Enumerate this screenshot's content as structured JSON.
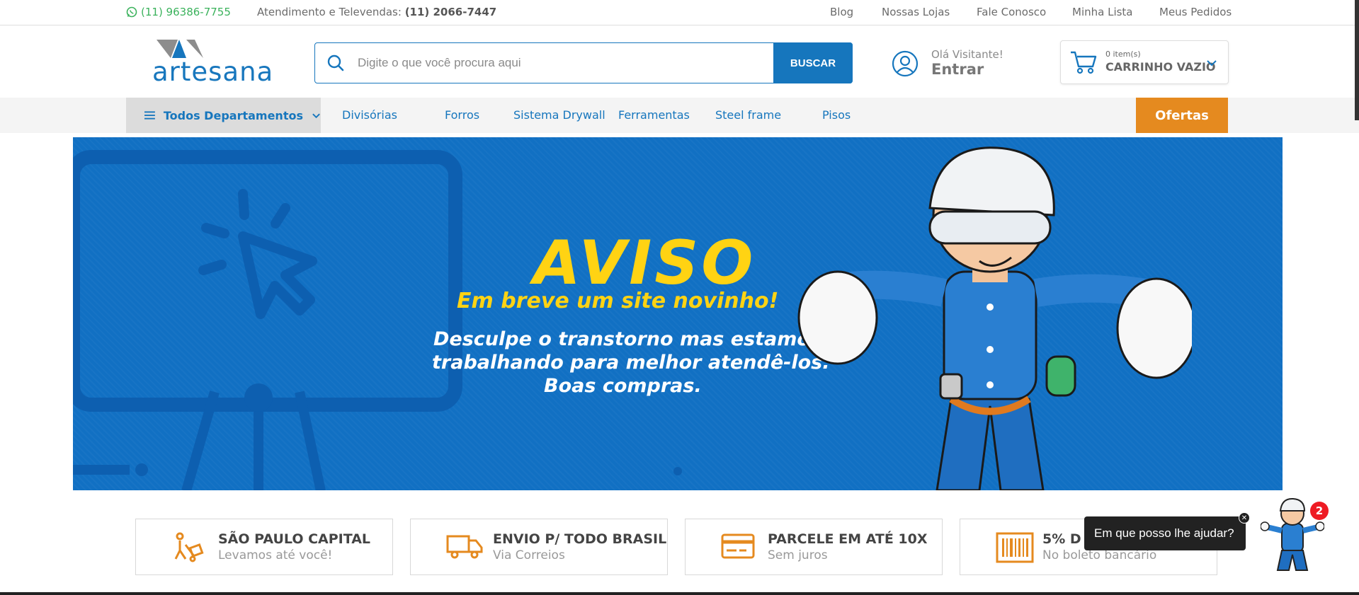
{
  "topbar": {
    "whatsapp": "(11) 96386-7755",
    "attendance_label": "Atendimento e Televendas:",
    "attendance_phone": "(11) 2066-7447",
    "links": [
      "Blog",
      "Nossas Lojas",
      "Fale Conosco",
      "Minha Lista",
      "Meus Pedidos"
    ]
  },
  "header": {
    "logo_text": "artesana",
    "search_placeholder": "Digite o que você procura aqui",
    "search_button": "BUSCAR",
    "greeting": "Olá Visitante!",
    "login": "Entrar",
    "cart_items": "0  item(s)",
    "cart_label": "CARRINHO VAZIO"
  },
  "nav": {
    "all_departments": "Todos Departamentos",
    "items": [
      "Divisórias",
      "Forros",
      "Sistema Drywall",
      "Ferramentas",
      "Steel frame",
      "Pisos"
    ],
    "offers": "Ofertas"
  },
  "banner": {
    "title": "AVISO",
    "subtitle": "Em breve um site novinho!",
    "line1": "Desculpe o transtorno mas estamos",
    "line2": "trabalhando para melhor atendê-los.",
    "line3": "Boas compras."
  },
  "features": [
    {
      "title": "SÃO PAULO CAPITAL",
      "subtitle": "Levamos até você!",
      "icon": "hand-truck-icon"
    },
    {
      "title": "ENVIO P/ TODO BRASIL",
      "subtitle": "Via Correios",
      "icon": "truck-icon"
    },
    {
      "title": "PARCELE EM ATÉ 10X",
      "subtitle": "Sem juros",
      "icon": "credit-card-icon"
    },
    {
      "title": "5% D",
      "subtitle": "No boleto bancário",
      "icon": "barcode-icon"
    }
  ],
  "chat": {
    "message": "Em que posso lhe ajudar?",
    "badge": "2"
  },
  "colors": {
    "brand_blue": "#1676bd",
    "whatsapp_green": "#3bb25c",
    "offer_orange": "#e58a1f",
    "banner_blue": "#1170c3",
    "banner_yellow": "#ffd313"
  }
}
